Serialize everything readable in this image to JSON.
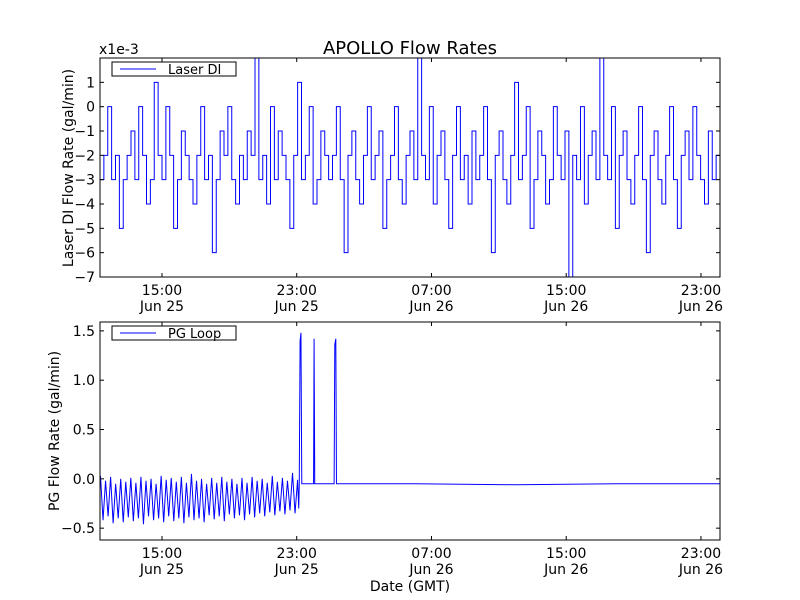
{
  "chart_data": [
    {
      "type": "line",
      "title": "APOLLO Flow Rates",
      "ylabel": "Laser DI Flow Rate (gal/min)",
      "xlabel": "",
      "y_scale_label": "x1e-3",
      "legend": {
        "label": "Laser DI",
        "placement": "top-left"
      },
      "color": "#0000ff",
      "xlim_hours_from_jun25_0000": [
        11.32,
        48.13
      ],
      "ylim": [
        -7,
        2
      ],
      "yticks": [
        1,
        0,
        -1,
        -2,
        -3,
        -4,
        -5,
        -6,
        -7
      ],
      "xticks_hours": [
        15,
        23,
        31,
        39,
        47
      ],
      "xtick_labels": [
        [
          "15:00",
          "Jun 25"
        ],
        [
          "23:00",
          "Jun 25"
        ],
        [
          "07:00",
          "Jun 26"
        ],
        [
          "15:00",
          "Jun 26"
        ],
        [
          "23:00",
          "Jun 26"
        ]
      ],
      "series": [
        {
          "name": "Laser DI",
          "values_x1e-3": [
            -3,
            -2,
            0,
            -3,
            -2,
            -5,
            -3,
            -2,
            -1,
            -3,
            0,
            -2,
            -4,
            -3,
            1,
            -2,
            -3,
            0,
            -2,
            -5,
            -3,
            -1,
            -2,
            -3,
            -4,
            -2,
            0,
            -3,
            -2,
            -6,
            -3,
            -1,
            -2,
            0,
            -3,
            -4,
            -2,
            -3,
            -1,
            -2,
            2,
            -3,
            -2,
            -4,
            0,
            -3,
            -1,
            -2,
            -3,
            -5,
            -2,
            1,
            -3,
            -2,
            0,
            -4,
            -3,
            -1,
            -2,
            -3,
            -2,
            0,
            -3,
            -6,
            -2,
            -1,
            -3,
            -4,
            -2,
            0,
            -3,
            -2,
            -1,
            -5,
            -3,
            -2,
            0,
            -3,
            -4,
            -2,
            -1,
            -3,
            2,
            -2,
            -3,
            0,
            -4,
            -2,
            -1,
            -3,
            -5,
            -2,
            0,
            -3,
            -2,
            -4,
            -1,
            -3,
            -2,
            0,
            -3,
            -6,
            -2,
            -1,
            -3,
            -4,
            -2,
            1,
            -3,
            -2,
            0,
            -5,
            -3,
            -1,
            -2,
            -4,
            -3,
            0,
            -2,
            -3,
            -1,
            -7,
            -2,
            -3,
            0,
            -4,
            -2,
            -1,
            -3,
            2,
            -2,
            -3,
            0,
            -5,
            -2,
            -1,
            -3,
            -4,
            -2,
            0,
            -3,
            -6,
            -2,
            -1,
            -3,
            -4,
            -2,
            0,
            -3,
            -5,
            -2,
            -1,
            -3,
            0,
            -2,
            -3,
            -4,
            -1,
            -3,
            -2
          ]
        }
      ]
    },
    {
      "type": "line",
      "title": "",
      "ylabel": "PG Flow Rate (gal/min)",
      "xlabel": "Date (GMT)",
      "legend": {
        "label": "PG Loop",
        "placement": "top-left"
      },
      "color": "#0000ff",
      "xlim_hours_from_jun25_0000": [
        11.32,
        48.13
      ],
      "ylim": [
        -0.62,
        1.59
      ],
      "yticks": [
        1.5,
        1.0,
        0.5,
        0.0,
        -0.5
      ],
      "ytick_labels": [
        "1.5",
        "1.0",
        "0.5",
        "0.0",
        "−0.5"
      ],
      "xticks_hours": [
        15,
        23,
        31,
        39,
        47
      ],
      "xtick_labels": [
        [
          "15:00",
          "Jun 25"
        ],
        [
          "23:00",
          "Jun 25"
        ],
        [
          "07:00",
          "Jun 26"
        ],
        [
          "15:00",
          "Jun 26"
        ],
        [
          "23:00",
          "Jun 26"
        ]
      ],
      "series": [
        {
          "name": "PG Loop",
          "points": [
            [
              11.35,
              0.03
            ],
            [
              11.5,
              -0.42
            ],
            [
              11.65,
              -0.02
            ],
            [
              11.8,
              -0.38
            ],
            [
              11.95,
              0.02
            ],
            [
              12.1,
              -0.45
            ],
            [
              12.25,
              -0.05
            ],
            [
              12.4,
              -0.4
            ],
            [
              12.55,
              0.0
            ],
            [
              12.7,
              -0.44
            ],
            [
              12.85,
              -0.03
            ],
            [
              13.0,
              -0.39
            ],
            [
              13.15,
              0.01
            ],
            [
              13.3,
              -0.43
            ],
            [
              13.45,
              -0.04
            ],
            [
              13.6,
              -0.4
            ],
            [
              13.75,
              0.02
            ],
            [
              13.9,
              -0.46
            ],
            [
              14.05,
              -0.02
            ],
            [
              14.2,
              -0.38
            ],
            [
              14.35,
              0.0
            ],
            [
              14.5,
              -0.42
            ],
            [
              14.65,
              -0.05
            ],
            [
              14.8,
              -0.4
            ],
            [
              14.95,
              0.03
            ],
            [
              15.1,
              -0.44
            ],
            [
              15.25,
              -0.01
            ],
            [
              15.4,
              -0.38
            ],
            [
              15.55,
              0.01
            ],
            [
              15.7,
              -0.43
            ],
            [
              15.85,
              -0.03
            ],
            [
              16.0,
              -0.4
            ],
            [
              16.15,
              0.02
            ],
            [
              16.3,
              -0.45
            ],
            [
              16.45,
              -0.04
            ],
            [
              16.6,
              -0.39
            ],
            [
              16.75,
              0.05
            ],
            [
              16.9,
              -0.42
            ],
            [
              17.05,
              -0.02
            ],
            [
              17.2,
              -0.4
            ],
            [
              17.35,
              0.0
            ],
            [
              17.5,
              -0.44
            ],
            [
              17.65,
              -0.05
            ],
            [
              17.8,
              -0.37
            ],
            [
              17.95,
              0.01
            ],
            [
              18.1,
              -0.41
            ],
            [
              18.25,
              -0.04
            ],
            [
              18.4,
              -0.38
            ],
            [
              18.55,
              0.02
            ],
            [
              18.7,
              -0.43
            ],
            [
              18.85,
              -0.03
            ],
            [
              19.0,
              -0.36
            ],
            [
              19.15,
              0.0
            ],
            [
              19.3,
              -0.4
            ],
            [
              19.45,
              -0.05
            ],
            [
              19.6,
              -0.37
            ],
            [
              19.75,
              0.01
            ],
            [
              19.9,
              -0.42
            ],
            [
              20.05,
              -0.04
            ],
            [
              20.2,
              -0.36
            ],
            [
              20.35,
              0.02
            ],
            [
              20.5,
              -0.39
            ],
            [
              20.65,
              -0.02
            ],
            [
              20.8,
              -0.35
            ],
            [
              20.95,
              0.0
            ],
            [
              21.1,
              -0.38
            ],
            [
              21.25,
              -0.04
            ],
            [
              21.4,
              -0.34
            ],
            [
              21.55,
              0.03
            ],
            [
              21.7,
              -0.37
            ],
            [
              21.85,
              -0.03
            ],
            [
              22.0,
              -0.33
            ],
            [
              22.15,
              0.01
            ],
            [
              22.3,
              -0.36
            ],
            [
              22.45,
              -0.02
            ],
            [
              22.6,
              -0.32
            ],
            [
              22.75,
              0.06
            ],
            [
              22.9,
              -0.35
            ],
            [
              23.05,
              -0.01
            ],
            [
              23.12,
              -0.3
            ],
            [
              23.15,
              -0.05
            ],
            [
              23.2,
              1.4
            ],
            [
              23.25,
              1.48
            ],
            [
              23.3,
              -0.05
            ],
            [
              24.0,
              -0.05
            ],
            [
              24.03,
              1.42
            ],
            [
              24.07,
              -0.05
            ],
            [
              25.22,
              -0.05
            ],
            [
              25.26,
              1.36
            ],
            [
              25.32,
              1.42
            ],
            [
              25.36,
              -0.05
            ],
            [
              30,
              -0.05
            ],
            [
              36,
              -0.06
            ],
            [
              42,
              -0.05
            ],
            [
              48.13,
              -0.05
            ]
          ]
        }
      ]
    }
  ]
}
